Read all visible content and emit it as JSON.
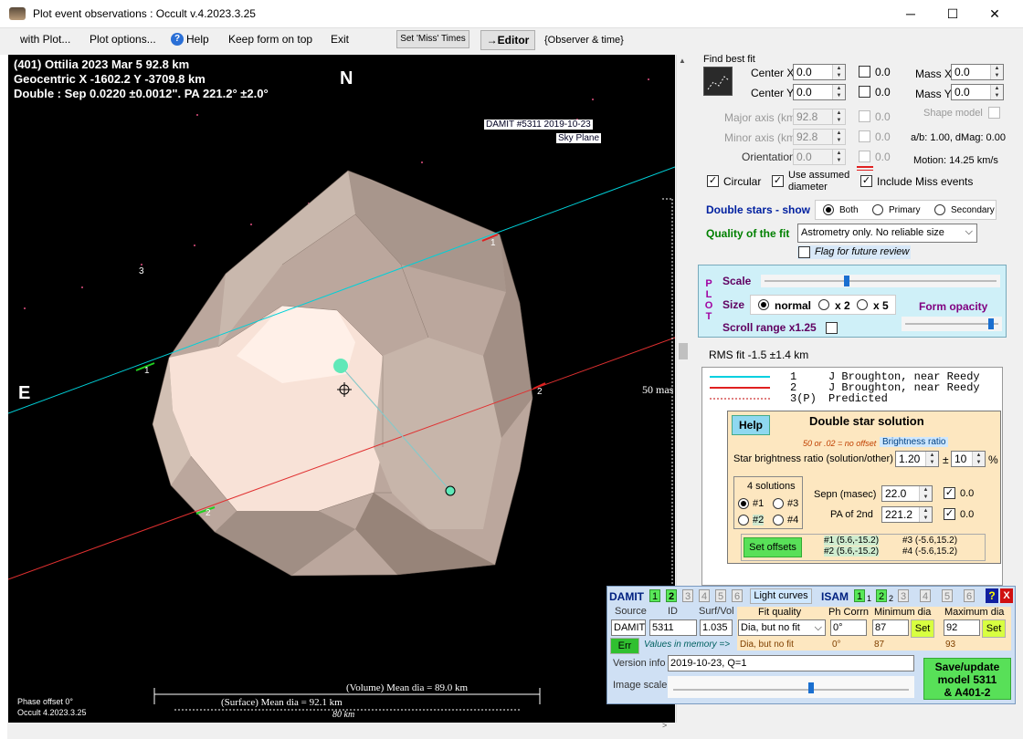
{
  "window": {
    "title": "Plot event observations : Occult v.4.2023.3.25",
    "min": "─",
    "max": "☐",
    "close": "✕"
  },
  "menu": {
    "items": [
      "with Plot...",
      "Plot options...",
      "Help",
      "Keep form on top",
      "Exit"
    ],
    "set_miss_times": "Set 'Miss' Times",
    "editor": "→Editor",
    "observer_time": "{Observer & time}"
  },
  "plot": {
    "line1": "(401) Ottilia  2023 Mar 5   92.8 km",
    "line2": "Geocentric  X  -1602.2  Y -3709.8 km",
    "line3": "Double : Sep  0.0220 ±0.0012\".  PA 221.2° ±2.0°",
    "north": "N",
    "east": "E",
    "model_label1": "DAMIT #5311 2019-10-23",
    "model_label2": "Sky Plane",
    "scale_label": "50 mas",
    "chord_labels": [
      "1",
      "1",
      "2",
      "2",
      "3",
      "1",
      "2"
    ],
    "volume_dia": "(Volume) Mean dia = 89.0 km",
    "surface_dia": "(Surface) Mean dia = 92.1 km",
    "scale_km": "80 km",
    "phase_offset": "Phase offset 0°",
    "occult_version": "Occult 4.2023.3.25"
  },
  "fit": {
    "title": "Find best fit",
    "center_x_label": "Center X",
    "center_x": "0.0",
    "center_x_chk": "0.0",
    "center_y_label": "Center Y",
    "center_y": "0.0",
    "center_y_chk": "0.0",
    "mass_x_label": "Mass X",
    "mass_x": "0.0",
    "mass_y_label": "Mass Y",
    "mass_y": "0.0",
    "major_label": "Major axis (km)",
    "major": "92.8",
    "major_chk": "0.0",
    "minor_label": "Minor axis (km)",
    "minor": "92.8",
    "minor_chk": "0.0",
    "orient_label": "Orientation",
    "orient": "0.0",
    "orient_chk": "0.0",
    "shape_model": "Shape model",
    "ab_dmag": "a/b: 1.00, dMag: 0.00",
    "motion": "Motion: 14.25 km/s",
    "circular": "Circular",
    "use_assumed": "Use assumed",
    "diameter": "diameter",
    "include_miss": "Include Miss events",
    "double_stars_show": "Double stars - show",
    "both": "Both",
    "primary": "Primary",
    "secondary": "Secondary",
    "quality_label": "Quality of the fit",
    "quality_value": "Astrometry only. No reliable size",
    "flag_review": "Flag for future review"
  },
  "plotpanel": {
    "plot_vertical": [
      "P",
      "L",
      "O",
      "T"
    ],
    "scale": "Scale",
    "size": "Size",
    "normal": "normal",
    "x2": "x 2",
    "x5": "x 5",
    "form_opacity": "Form opacity",
    "scroll_range": "Scroll range x1.25",
    "scale_level": 0.35,
    "opacity_level": 0.95
  },
  "rms": "RMS fit -1.5 ±1.4 km",
  "legend": [
    {
      "num": "1",
      "name": "J Broughton, near Reedy",
      "color": "#00d0e0"
    },
    {
      "num": "2",
      "name": "J Broughton, near Reedy",
      "color": "#e02020"
    },
    {
      "num": "3(P)",
      "name": "Predicted",
      "color": "#e08080"
    }
  ],
  "double_star": {
    "help": "Help",
    "title": "Double star solution",
    "offset_note": "50 or .02 = no offset",
    "brightness_ratio": "Brightness ratio",
    "star_brightness_label": "Star brightness ratio (solution/other)",
    "brightness_value": "1.20",
    "pm": "±",
    "pm_value": "10",
    "pct": "%",
    "solutions_title": "4 solutions",
    "sol": [
      "#1",
      "#2",
      "#3",
      "#4"
    ],
    "sepn_label": "Sepn (masec)",
    "sepn": "22.0",
    "sepn_chk": "0.0",
    "pa_label": "PA of 2nd",
    "pa": "221.2",
    "pa_chk": "0.0",
    "set_offsets": "Set offsets",
    "off1": "#1 (5.6,-15.2)",
    "off2": "#2 (5.6,-15.2)",
    "off3": "#3 (-5.6,15.2)",
    "off4": "#4 (-5.6,15.2)"
  },
  "models": {
    "damit": "DAMIT",
    "damit_nums": [
      "1",
      "2",
      "3",
      "4",
      "5",
      "6"
    ],
    "light_curves": "Light curves",
    "isam": "ISAM",
    "isam_nums": [
      "1",
      "1",
      "2",
      "2",
      "3",
      "3",
      "4",
      "5",
      "6"
    ],
    "help": "?",
    "close": "X",
    "source_label": "Source",
    "id_label": "ID",
    "surf_label": "Surf/Vol",
    "source": "DAMIT",
    "id": "5311",
    "surf": "1.035",
    "fit_quality_label": "Fit quality",
    "fit_quality": "Dia, but no fit",
    "ph_corr_label": "Ph Corrn",
    "ph_corr": "0°",
    "min_dia_label": "Minimum dia",
    "min_dia": "87",
    "max_dia_label": "Maximum dia",
    "max_dia": "92",
    "set": "Set",
    "err": "Err",
    "values_memory": "Values in memory =>",
    "mem_fit": "Dia, but no fit",
    "mem_ph": "0°",
    "mem_min": "87",
    "mem_max": "93",
    "version_label": "Version info",
    "version": "2019-10-23, Q=1",
    "image_scale": "Image scale",
    "save": "Save/update",
    "save2": "model 5311",
    "save3": "& A401-2"
  }
}
